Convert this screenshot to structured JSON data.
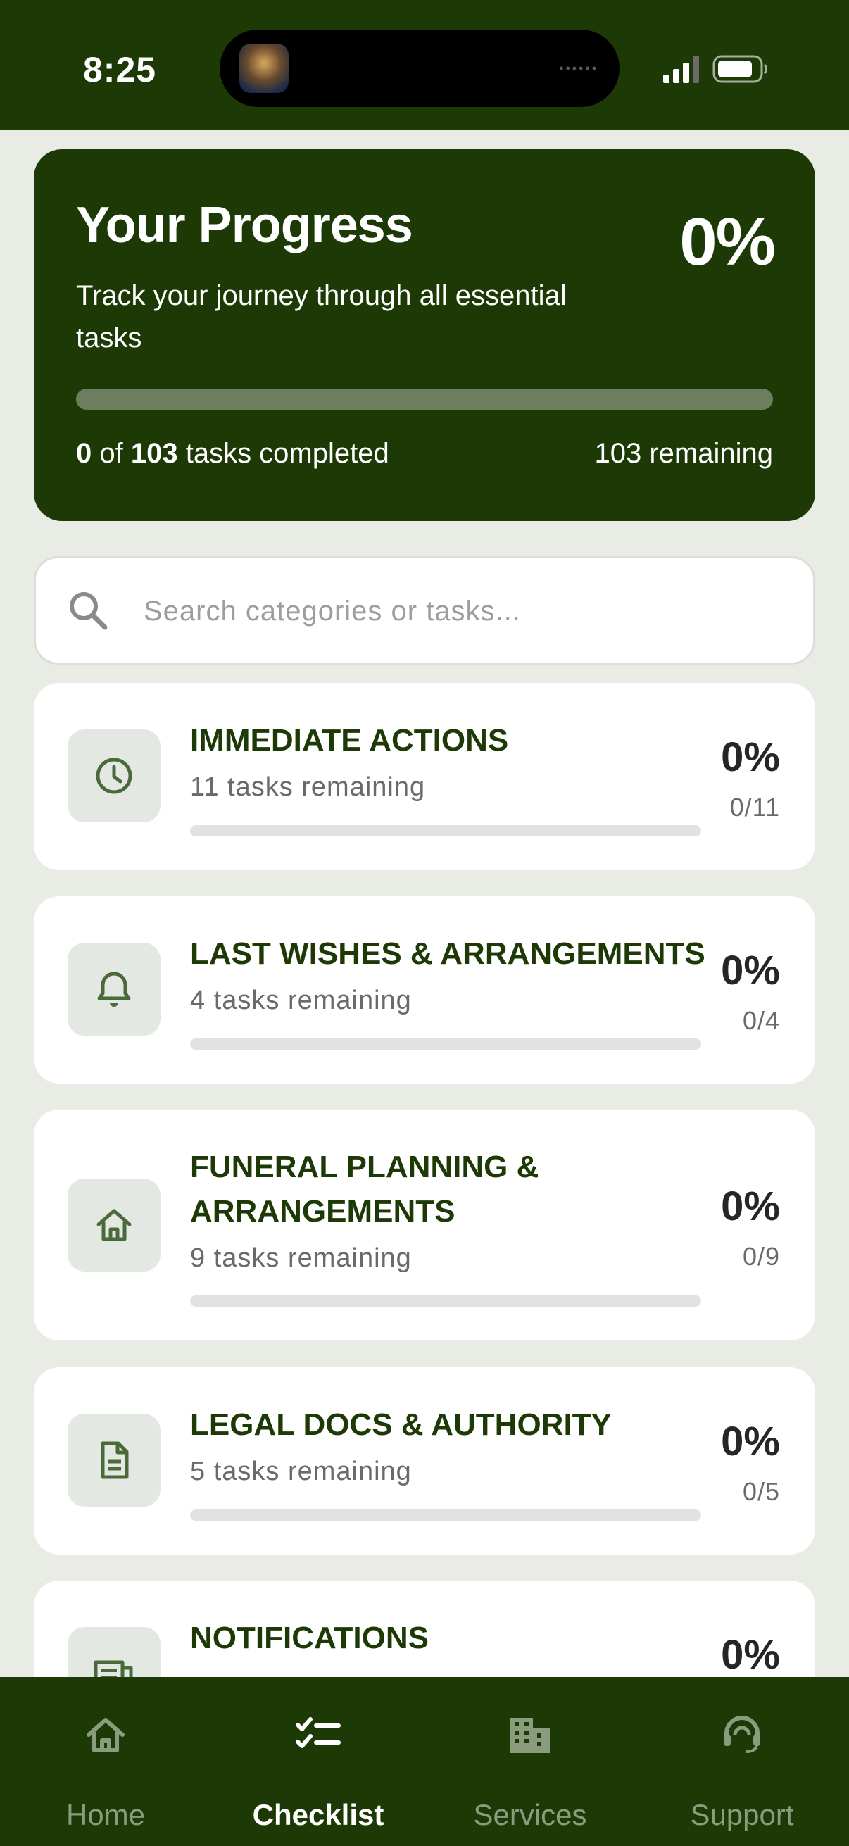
{
  "status_bar": {
    "time": "8:25"
  },
  "progress": {
    "title": "Your Progress",
    "subtitle": "Track your journey through all essential tasks",
    "percent_label": "0%",
    "completed_fraction": 0,
    "completed": "0",
    "total": "103",
    "count_mid": " of ",
    "count_suffix": " tasks completed",
    "remaining_label": "103 remaining"
  },
  "search": {
    "placeholder": "Search categories or tasks..."
  },
  "categories": [
    {
      "title": "IMMEDIATE ACTIONS",
      "remaining": "11 tasks remaining",
      "percent": "0%",
      "count": "0/11",
      "icon": "clock-icon"
    },
    {
      "title": "LAST WISHES & ARRANGEMENTS",
      "remaining": "4 tasks remaining",
      "percent": "0%",
      "count": "0/4",
      "icon": "bell-icon"
    },
    {
      "title": "FUNERAL PLANNING & ARRANGEMENTS",
      "remaining": "9 tasks remaining",
      "percent": "0%",
      "count": "0/9",
      "icon": "home-icon"
    },
    {
      "title": "LEGAL DOCS & AUTHORITY",
      "remaining": "5 tasks remaining",
      "percent": "0%",
      "count": "0/5",
      "icon": "document-icon"
    },
    {
      "title": "NOTIFICATIONS",
      "percent": "0%",
      "icon": "newspaper-icon"
    }
  ],
  "bottom_nav": {
    "items": [
      {
        "label": "Home",
        "icon": "home-icon",
        "active": false
      },
      {
        "label": "Checklist",
        "icon": "checklist-icon",
        "active": true
      },
      {
        "label": "Services",
        "icon": "building-icon",
        "active": false
      },
      {
        "label": "Support",
        "icon": "headset-icon",
        "active": false
      }
    ]
  },
  "colors": {
    "brand_dark_green": "#1d3a06",
    "background": "#e8ece5",
    "icon_tint": "#4a6a3a",
    "inactive_nav": "#8a9c7e"
  }
}
